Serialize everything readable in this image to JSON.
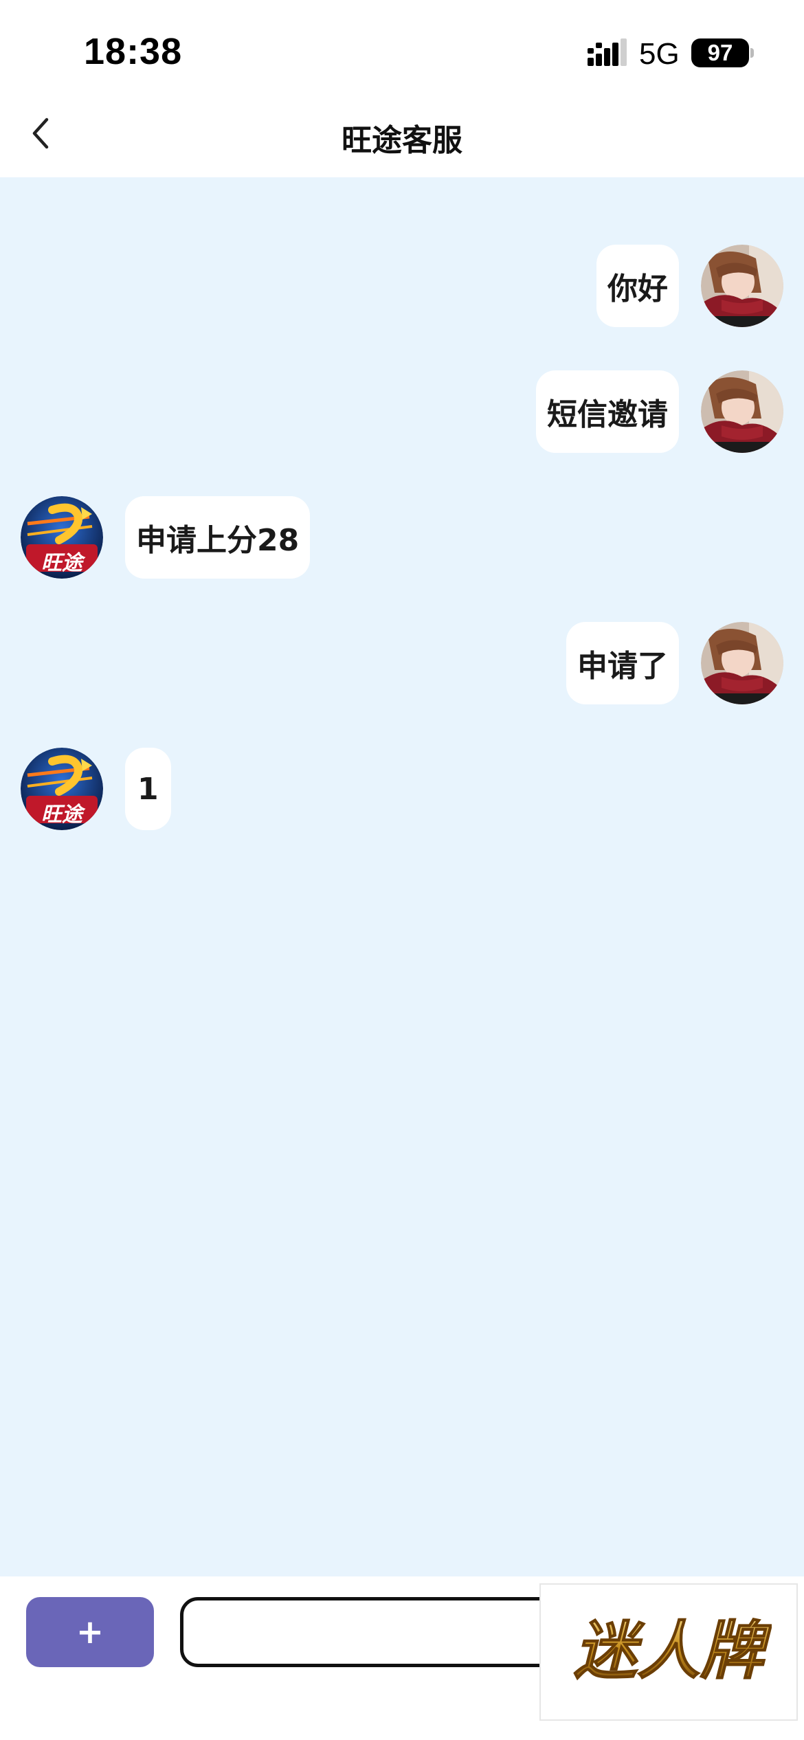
{
  "status_bar": {
    "time": "18:38",
    "network": "5G",
    "battery": "97",
    "icons": [
      "signal-icon",
      "battery-icon"
    ]
  },
  "header": {
    "title": "旺途客服",
    "back_icon": "chevron-left-icon"
  },
  "agent": {
    "avatar_text": "旺途"
  },
  "messages": [
    {
      "sender": "user",
      "text": "你好"
    },
    {
      "sender": "user",
      "text": "短信邀请"
    },
    {
      "sender": "agent",
      "text": "申请上分28"
    },
    {
      "sender": "user",
      "text": "申请了"
    },
    {
      "sender": "agent",
      "text": "1"
    }
  ],
  "composer": {
    "plus_label": "+",
    "input_value": "",
    "input_placeholder": ""
  },
  "watermark": {
    "text": "迷人牌"
  },
  "colors": {
    "chat_background": "#e8f4fd",
    "bubble": "#ffffff",
    "plus_button": "#6a66b8"
  }
}
